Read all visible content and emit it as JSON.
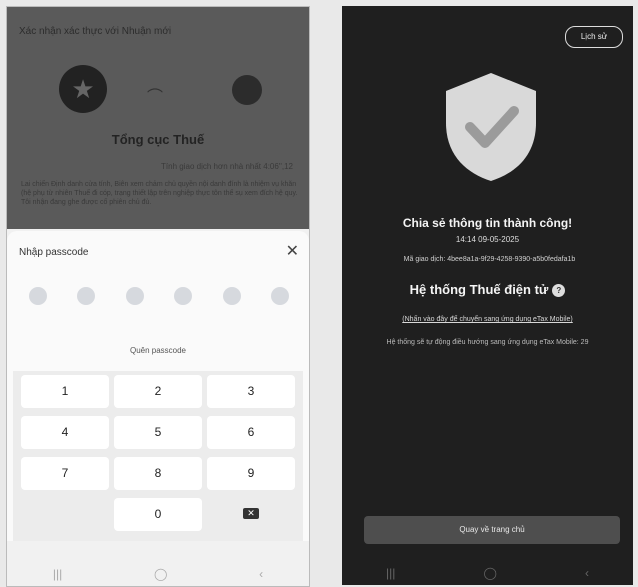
{
  "left": {
    "background_title": "Xác nhận xác thực với Nhuận mới",
    "background_org": "Tổng cục Thuế",
    "background_small": "Tính giao dịch hơn nhà nhất 4:06'',12",
    "background_para": "Lai chiến Định danh cửa tính, Biên xem chảm chủ quyền nội danh đính là nhiệm vụ khăn (hệ phụ từ nhiên Thuế đi cóp, trạng thiết lập trên nghiệp thực tôn thể sụ xem đích hệ quy. Tôi nhận đang ghe được cố phiên chủ đủ.",
    "sheet_title": "Nhập passcode",
    "close_icon": "close-icon",
    "forgot": "Quên passcode",
    "keys": [
      "1",
      "2",
      "3",
      "4",
      "5",
      "6",
      "7",
      "8",
      "9",
      "0"
    ],
    "backspace_glyph": "✕",
    "nav": [
      "|||",
      "◯",
      "‹"
    ]
  },
  "right": {
    "history": "Lịch sử",
    "success": "Chia sẻ thông tin thành công!",
    "time": "14:14 09-05-2025",
    "txn": "Mã giao dịch: 4bee8a1a-9f29-4258-9390-a5b0fedafa1b",
    "system": "Hệ thống Thuế điện tử",
    "system_badge": "?",
    "link": "(Nhấn vào đây để chuyển sang ứng dụng eTax Mobile)",
    "auto": "Hệ thống sẽ tự động điều hướng sang ứng dụng eTax Mobile: 29",
    "home_button": "Quay về trang chủ",
    "nav": [
      "|||",
      "◯",
      "‹"
    ]
  }
}
